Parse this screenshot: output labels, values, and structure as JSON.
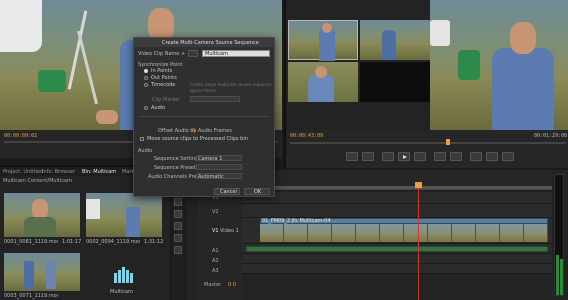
{
  "source_monitor": {
    "timecode_left": "00:00:09:02"
  },
  "program_monitor": {
    "timecode_left": "00:00:43:09",
    "timecode_right": "00:01:29:00"
  },
  "dialog": {
    "title": "Create Multi-Camera Source Sequence",
    "clip_name_label": "Video Clip Name + ",
    "clip_name_value": "Multicam",
    "sync_point_label": "Synchronize Point",
    "in_points": "In Points",
    "out_points": "Out Points",
    "timecode": "Timecode",
    "timecode_hint": "Create single multicam source sequence",
    "ignore_hours": "Ignore Hours",
    "clip_marker": "Clip Marker",
    "audio": "Audio",
    "offset_audio": "Offset Audio by",
    "offset_value": "0",
    "offset_unit": "Audio Frames",
    "move_clips": "Move source clips to Processed Clips bin",
    "audio_section": "Audio",
    "sequence_settings_label": "Sequence Settings",
    "sequence_settings_value": "Camera 1",
    "sequence_preset_label": "Sequence Preset",
    "audio_channels_label": "Audio Channels Preset",
    "audio_channels_value": "Automatic",
    "cancel": "Cancel",
    "ok": "OK"
  },
  "project_panel": {
    "tabs": [
      "Project: Untitled",
      "Info: Browser",
      "Bin: Multicam",
      "Markers"
    ],
    "path": "Multicam Content/Multicam",
    "items": [
      {
        "name": "0001_0081_1119.mov.mov",
        "duration": "1:01:17"
      },
      {
        "name": "0002_0094_1119.mov",
        "duration": "1:31:12"
      },
      {
        "name": "0003_0071_1119.mov",
        "duration": "1:01:22"
      },
      {
        "name": "Multicam",
        "duration": ""
      }
    ]
  },
  "timeline": {
    "clip_label": "01_FM09_2 Jfx Multicam-04",
    "track_labels": [
      "V3",
      "V2",
      "V1",
      "A1",
      "A2",
      "A3"
    ],
    "master_label": "Master",
    "master_value": "0.0",
    "v1_name": "Video 1"
  },
  "colors": {
    "accent": "#e8a23a",
    "clip": "#5d7e99",
    "audio": "#3a6f43",
    "playhead": "#d2392b"
  }
}
